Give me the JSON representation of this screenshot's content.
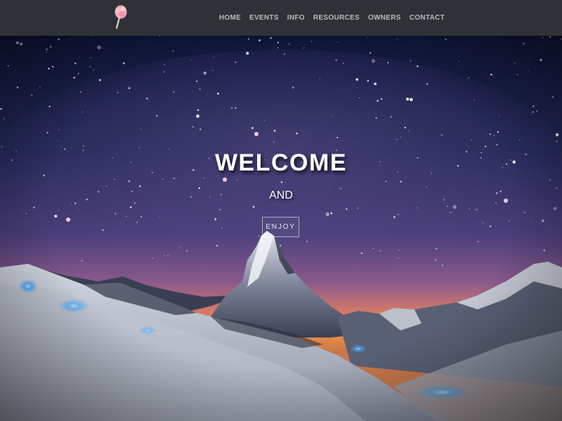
{
  "nav": {
    "logo_icon": "cotton-candy-icon",
    "links": [
      "HOME",
      "EVENTS",
      "INFO",
      "RESOURCES",
      "OWNERS",
      "CONTACT"
    ]
  },
  "hero": {
    "title": "WELCOME",
    "subtitle": "AND",
    "button_label": "ENJOY"
  },
  "colors": {
    "navbar": "#2e3236",
    "nav_text": "#b9bcc0",
    "sky_top": "#141a3a",
    "horizon_glow": "#f08a3c",
    "snow": "#d8dde6",
    "glow_blue": "#3fa9ff"
  }
}
